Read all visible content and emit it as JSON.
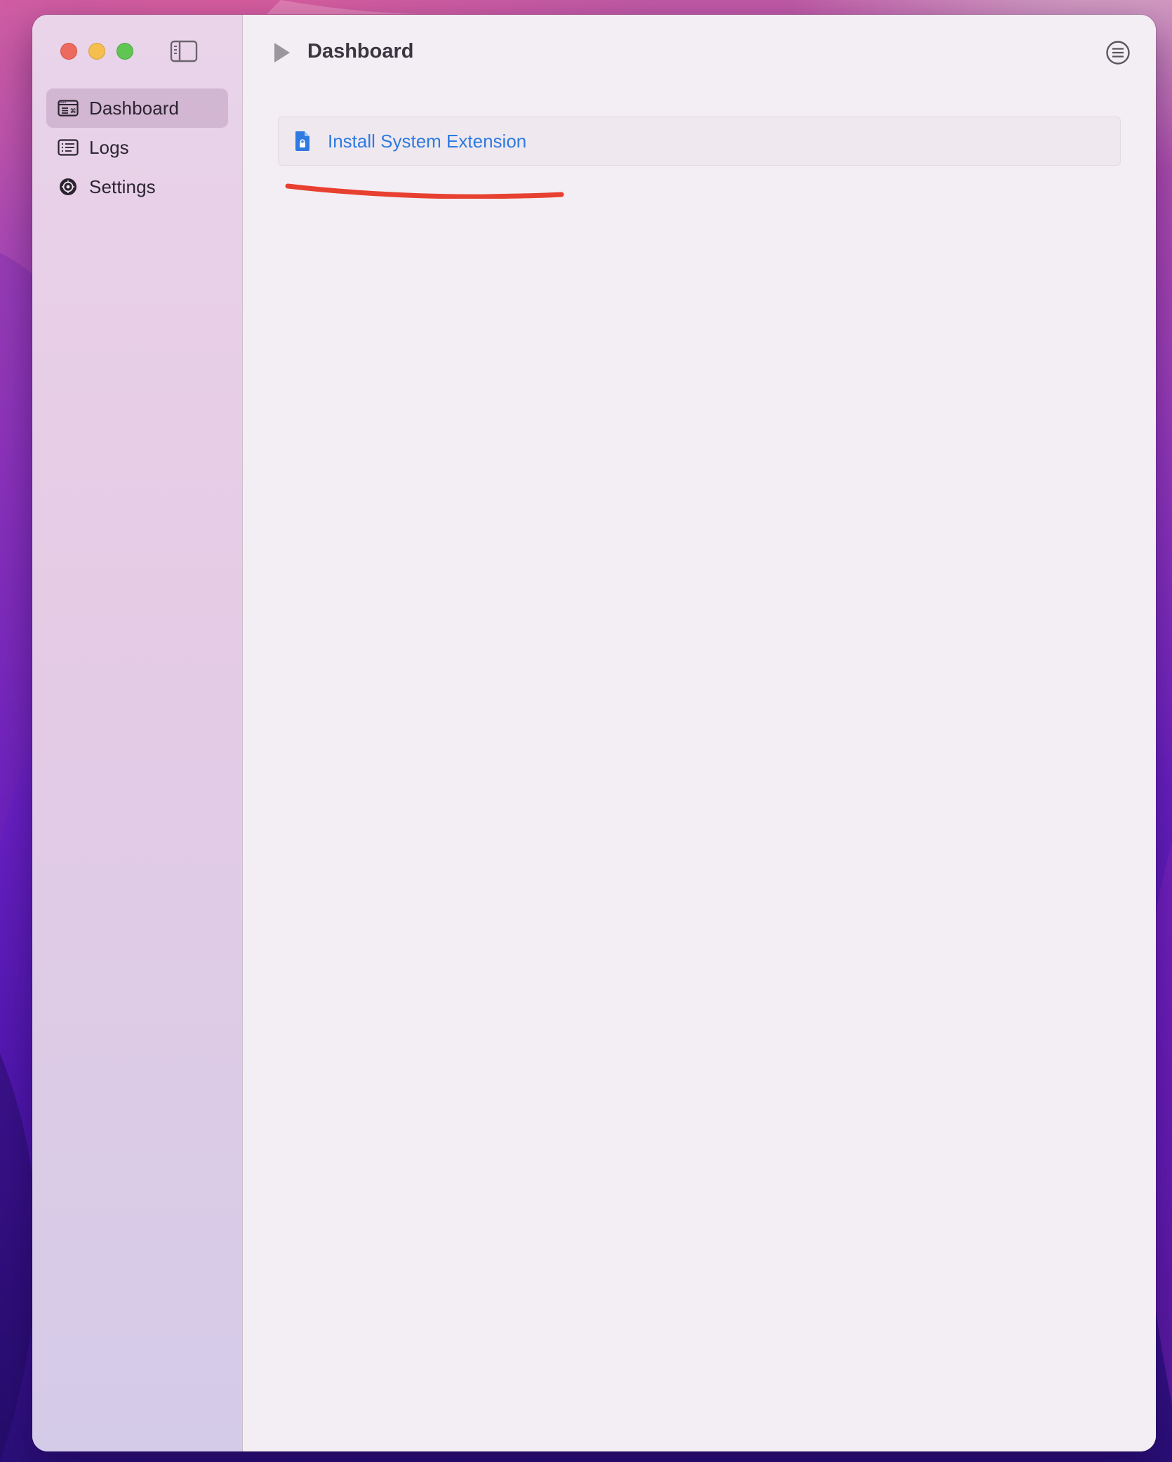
{
  "window": {
    "toolbar": {
      "title": "Dashboard"
    },
    "sidebar": {
      "items": [
        {
          "label": "Dashboard",
          "icon": "dashboard-window-icon",
          "selected": true
        },
        {
          "label": "Logs",
          "icon": "list-icon",
          "selected": false
        },
        {
          "label": "Settings",
          "icon": "gear-icon",
          "selected": false
        }
      ]
    },
    "main": {
      "actions": [
        {
          "label": "Install System Extension",
          "icon": "locked-document-icon"
        }
      ]
    }
  },
  "colors": {
    "accent_link": "#2f7ae0",
    "annotation_stroke": "#e84030",
    "close": "#ed6a5e",
    "minimize": "#f5bf4f",
    "maximize": "#61c554"
  }
}
